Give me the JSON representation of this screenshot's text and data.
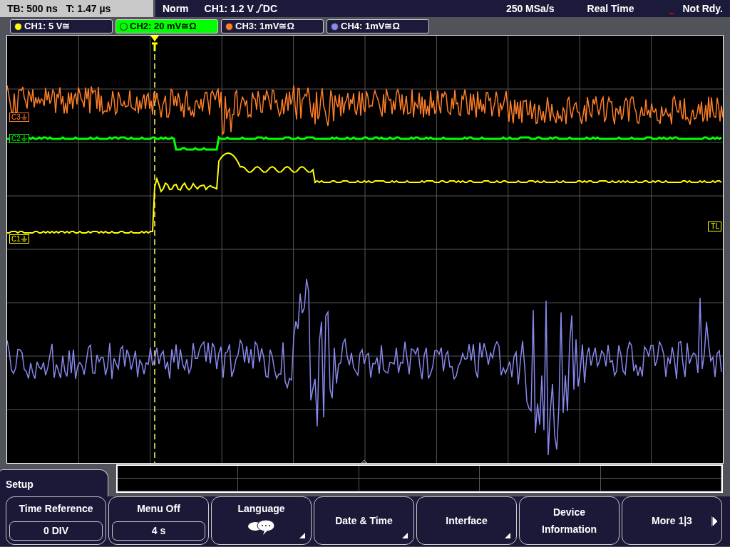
{
  "status_bar": {
    "timebase": "TB: 500 ns",
    "trigger_time": "T: 1.47 µs",
    "mode": "Norm",
    "trigger_source": "CH1: 1.2 V",
    "coupling": "DC",
    "sample_rate": "250 MSa/s",
    "acquisition": "Real Time",
    "state": "Not Rdy."
  },
  "channels": [
    {
      "label": "CH1: 5 V≅",
      "color": "#ffff00",
      "selected": false
    },
    {
      "label": "CH2: 20 mV≅Ω",
      "color": "#00ff00",
      "selected": true
    },
    {
      "label": "CH3: 1mV≅Ω",
      "color": "#ff7f27",
      "selected": false
    },
    {
      "label": "CH4: 1mV≅Ω",
      "color": "#8888ee",
      "selected": false
    }
  ],
  "markers": [
    {
      "label": "C3",
      "color": "#ff7f27"
    },
    {
      "label": "C2",
      "color": "#00ff00"
    },
    {
      "label": "C1",
      "color": "#ffff00"
    }
  ],
  "trigger_level_marker": "TL",
  "menu": {
    "title": "Setup",
    "buttons": [
      {
        "kind": "value",
        "label": "Time Reference",
        "value": "0 DIV"
      },
      {
        "kind": "value",
        "label": "Menu Off",
        "value": "4 s"
      },
      {
        "kind": "icon",
        "label": "Language",
        "submenu": true
      },
      {
        "kind": "plain",
        "label": "Date & Time",
        "submenu": true
      },
      {
        "kind": "plain",
        "label": "Interface",
        "submenu": true
      },
      {
        "kind": "plain",
        "label": "Device Information",
        "submenu": false
      },
      {
        "kind": "next",
        "label": "More 1|3"
      }
    ]
  }
}
